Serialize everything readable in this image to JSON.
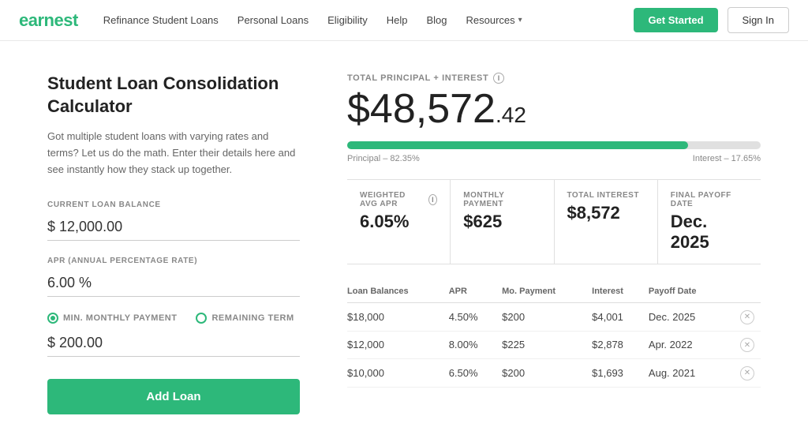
{
  "logo": "earnest",
  "nav": {
    "links": [
      {
        "label": "Refinance Student Loans",
        "id": "refinance"
      },
      {
        "label": "Personal Loans",
        "id": "personal"
      },
      {
        "label": "Eligibility",
        "id": "eligibility"
      },
      {
        "label": "Help",
        "id": "help"
      },
      {
        "label": "Blog",
        "id": "blog"
      },
      {
        "label": "Resources",
        "id": "resources",
        "hasDropdown": true
      }
    ],
    "cta": "Get Started",
    "sign_in": "Sign In"
  },
  "calculator": {
    "title": "Student Loan Consolidation Calculator",
    "description": "Got multiple student loans with varying rates and terms? Let us do the math. Enter their details here and see instantly how they stack up together.",
    "fields": {
      "balance_label": "CURRENT LOAN BALANCE",
      "balance_value": "$ 12,000.00",
      "apr_label": "APR (ANNUAL PERCENTAGE RATE)",
      "apr_value": "6.00 %",
      "payment_label_option1": "MIN. MONTHLY PAYMENT",
      "payment_label_option2": "REMAINING TERM",
      "payment_value": "$ 200.00"
    },
    "add_loan_btn": "Add Loan"
  },
  "results": {
    "total_label": "TOTAL PRINCIPAL + INTEREST",
    "total_dollars": "$48,572",
    "total_cents": ".42",
    "progress": {
      "fill_pct": 82.35,
      "label_left": "Principal – 82.35%",
      "label_right": "Interest – 17.65%"
    },
    "stats": [
      {
        "label": "WEIGHTED AVG APR",
        "value": "6.05%",
        "has_info": true
      },
      {
        "label": "MONTHLY PAYMENT",
        "value": "$625"
      },
      {
        "label": "TOTAL INTEREST",
        "value": "$8,572"
      },
      {
        "label": "FINAL PAYOFF DATE",
        "value": "Dec. 2025"
      }
    ],
    "table": {
      "headers": [
        "Loan Balances",
        "APR",
        "Mo. Payment",
        "Interest",
        "Payoff Date",
        ""
      ],
      "rows": [
        {
          "balance": "$18,000",
          "apr": "4.50%",
          "payment": "$200",
          "interest": "$4,001",
          "payoff": "Dec. 2025"
        },
        {
          "balance": "$12,000",
          "apr": "8.00%",
          "payment": "$225",
          "interest": "$2,878",
          "payoff": "Apr. 2022"
        },
        {
          "balance": "$10,000",
          "apr": "6.50%",
          "payment": "$200",
          "interest": "$1,693",
          "payoff": "Aug. 2021"
        }
      ]
    }
  }
}
